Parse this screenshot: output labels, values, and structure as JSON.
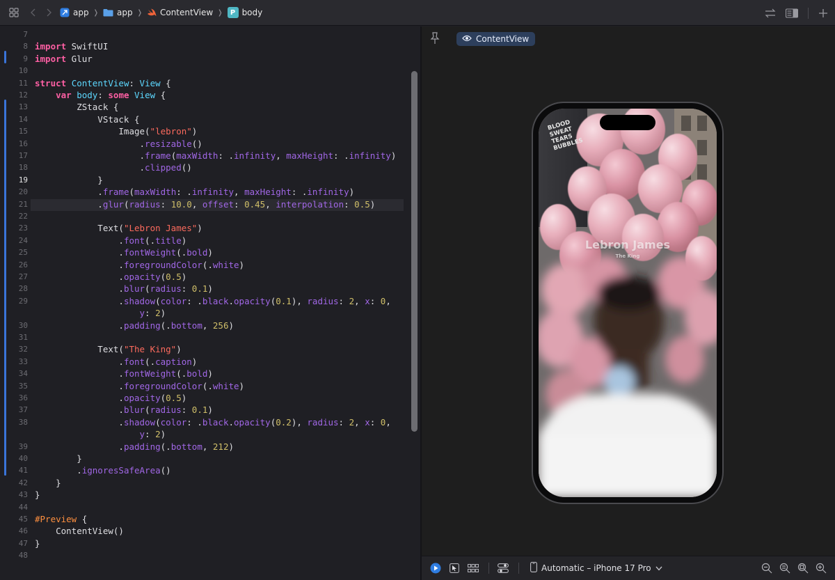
{
  "breadcrumb": [
    {
      "label": "app",
      "icon": "app-project-icon"
    },
    {
      "label": "app",
      "icon": "folder-icon"
    },
    {
      "label": "ContentView",
      "icon": "swift-icon"
    },
    {
      "label": "body",
      "icon": "property-icon",
      "badge": "P"
    }
  ],
  "code_lines": [
    {
      "n": "7",
      "tokens": []
    },
    {
      "n": "8",
      "tokens": [
        [
          "kw",
          "import"
        ],
        [
          "plain",
          " SwiftUI"
        ]
      ]
    },
    {
      "n": "9",
      "tokens": [
        [
          "kw",
          "import"
        ],
        [
          "plain",
          " Glur"
        ]
      ]
    },
    {
      "n": "10",
      "tokens": []
    },
    {
      "n": "11",
      "tokens": [
        [
          "kw",
          "struct"
        ],
        [
          "plain",
          " "
        ],
        [
          "type",
          "ContentView"
        ],
        [
          "plain",
          ": "
        ],
        [
          "type",
          "View"
        ],
        [
          "plain",
          " {"
        ]
      ]
    },
    {
      "n": "12",
      "tokens": [
        [
          "plain",
          "    "
        ],
        [
          "kw",
          "var"
        ],
        [
          "plain",
          " "
        ],
        [
          "type",
          "body"
        ],
        [
          "plain",
          ": "
        ],
        [
          "kw",
          "some"
        ],
        [
          "plain",
          " "
        ],
        [
          "type",
          "View"
        ],
        [
          "plain",
          " {"
        ]
      ]
    },
    {
      "n": "13",
      "tokens": [
        [
          "plain",
          "        ZStack {"
        ]
      ]
    },
    {
      "n": "14",
      "tokens": [
        [
          "plain",
          "            VStack {"
        ]
      ]
    },
    {
      "n": "15",
      "tokens": [
        [
          "plain",
          "                Image("
        ],
        [
          "str",
          "\"lebron\""
        ],
        [
          "plain",
          ")"
        ]
      ]
    },
    {
      "n": "16",
      "tokens": [
        [
          "plain",
          "                    ."
        ],
        [
          "fn",
          "resizable"
        ],
        [
          "plain",
          "()"
        ]
      ]
    },
    {
      "n": "17",
      "tokens": [
        [
          "plain",
          "                    ."
        ],
        [
          "fn",
          "frame"
        ],
        [
          "plain",
          "("
        ],
        [
          "fn",
          "maxWidth"
        ],
        [
          "plain",
          ": ."
        ],
        [
          "fn",
          "infinity"
        ],
        [
          "plain",
          ", "
        ],
        [
          "fn",
          "maxHeight"
        ],
        [
          "plain",
          ": ."
        ],
        [
          "fn",
          "infinity"
        ],
        [
          "plain",
          ")"
        ]
      ]
    },
    {
      "n": "18",
      "tokens": [
        [
          "plain",
          "                    ."
        ],
        [
          "fn",
          "clipped"
        ],
        [
          "plain",
          "()"
        ]
      ]
    },
    {
      "n": "19",
      "tokens": [
        [
          "plain",
          "            }"
        ]
      ]
    },
    {
      "n": "20",
      "tokens": [
        [
          "plain",
          "            ."
        ],
        [
          "fn",
          "frame"
        ],
        [
          "plain",
          "("
        ],
        [
          "fn",
          "maxWidth"
        ],
        [
          "plain",
          ": ."
        ],
        [
          "fn",
          "infinity"
        ],
        [
          "plain",
          ", "
        ],
        [
          "fn",
          "maxHeight"
        ],
        [
          "plain",
          ": ."
        ],
        [
          "fn",
          "infinity"
        ],
        [
          "plain",
          ")"
        ]
      ]
    },
    {
      "n": "21",
      "tokens": [
        [
          "plain",
          "            ."
        ],
        [
          "fn",
          "glur"
        ],
        [
          "plain",
          "("
        ],
        [
          "fn",
          "radius"
        ],
        [
          "plain",
          ": "
        ],
        [
          "num",
          "10.0"
        ],
        [
          "plain",
          ", "
        ],
        [
          "fn",
          "offset"
        ],
        [
          "plain",
          ": "
        ],
        [
          "num",
          "0.45"
        ],
        [
          "plain",
          ", "
        ],
        [
          "fn",
          "interpolation"
        ],
        [
          "plain",
          ": "
        ],
        [
          "num",
          "0.5"
        ],
        [
          "plain",
          ")"
        ]
      ]
    },
    {
      "n": "22",
      "tokens": []
    },
    {
      "n": "23",
      "tokens": [
        [
          "plain",
          "            Text("
        ],
        [
          "str",
          "\"Lebron James\""
        ],
        [
          "plain",
          ")"
        ]
      ]
    },
    {
      "n": "24",
      "tokens": [
        [
          "plain",
          "                ."
        ],
        [
          "fn",
          "font"
        ],
        [
          "plain",
          "(."
        ],
        [
          "fn",
          "title"
        ],
        [
          "plain",
          ")"
        ]
      ]
    },
    {
      "n": "25",
      "tokens": [
        [
          "plain",
          "                ."
        ],
        [
          "fn",
          "fontWeight"
        ],
        [
          "plain",
          "(."
        ],
        [
          "fn",
          "bold"
        ],
        [
          "plain",
          ")"
        ]
      ]
    },
    {
      "n": "26",
      "tokens": [
        [
          "plain",
          "                ."
        ],
        [
          "fn",
          "foregroundColor"
        ],
        [
          "plain",
          "(."
        ],
        [
          "fn",
          "white"
        ],
        [
          "plain",
          ")"
        ]
      ]
    },
    {
      "n": "27",
      "tokens": [
        [
          "plain",
          "                ."
        ],
        [
          "fn",
          "opacity"
        ],
        [
          "plain",
          "("
        ],
        [
          "num",
          "0.5"
        ],
        [
          "plain",
          ")"
        ]
      ]
    },
    {
      "n": "28",
      "tokens": [
        [
          "plain",
          "                ."
        ],
        [
          "fn",
          "blur"
        ],
        [
          "plain",
          "("
        ],
        [
          "fn",
          "radius"
        ],
        [
          "plain",
          ": "
        ],
        [
          "num",
          "0.1"
        ],
        [
          "plain",
          ")"
        ]
      ]
    },
    {
      "n": "29",
      "tokens": [
        [
          "plain",
          "                ."
        ],
        [
          "fn",
          "shadow"
        ],
        [
          "plain",
          "("
        ],
        [
          "fn",
          "color"
        ],
        [
          "plain",
          ": ."
        ],
        [
          "fn",
          "black"
        ],
        [
          "plain",
          "."
        ],
        [
          "fn",
          "opacity"
        ],
        [
          "plain",
          "("
        ],
        [
          "num",
          "0.1"
        ],
        [
          "plain",
          "), "
        ],
        [
          "fn",
          "radius"
        ],
        [
          "plain",
          ": "
        ],
        [
          "num",
          "2"
        ],
        [
          "plain",
          ", "
        ],
        [
          "fn",
          "x"
        ],
        [
          "plain",
          ": "
        ],
        [
          "num",
          "0"
        ],
        [
          "plain",
          ","
        ]
      ]
    },
    {
      "n": "",
      "tokens": [
        [
          "plain",
          "                    "
        ],
        [
          "fn",
          "y"
        ],
        [
          "plain",
          ": "
        ],
        [
          "num",
          "2"
        ],
        [
          "plain",
          ")"
        ]
      ]
    },
    {
      "n": "30",
      "tokens": [
        [
          "plain",
          "                ."
        ],
        [
          "fn",
          "padding"
        ],
        [
          "plain",
          "(."
        ],
        [
          "fn",
          "bottom"
        ],
        [
          "plain",
          ", "
        ],
        [
          "num",
          "256"
        ],
        [
          "plain",
          ")"
        ]
      ]
    },
    {
      "n": "31",
      "tokens": []
    },
    {
      "n": "32",
      "tokens": [
        [
          "plain",
          "            Text("
        ],
        [
          "str",
          "\"The King\""
        ],
        [
          "plain",
          ")"
        ]
      ]
    },
    {
      "n": "33",
      "tokens": [
        [
          "plain",
          "                ."
        ],
        [
          "fn",
          "font"
        ],
        [
          "plain",
          "(."
        ],
        [
          "fn",
          "caption"
        ],
        [
          "plain",
          ")"
        ]
      ]
    },
    {
      "n": "34",
      "tokens": [
        [
          "plain",
          "                ."
        ],
        [
          "fn",
          "fontWeight"
        ],
        [
          "plain",
          "(."
        ],
        [
          "fn",
          "bold"
        ],
        [
          "plain",
          ")"
        ]
      ]
    },
    {
      "n": "35",
      "tokens": [
        [
          "plain",
          "                ."
        ],
        [
          "fn",
          "foregroundColor"
        ],
        [
          "plain",
          "(."
        ],
        [
          "fn",
          "white"
        ],
        [
          "plain",
          ")"
        ]
      ]
    },
    {
      "n": "36",
      "tokens": [
        [
          "plain",
          "                ."
        ],
        [
          "fn",
          "opacity"
        ],
        [
          "plain",
          "("
        ],
        [
          "num",
          "0.5"
        ],
        [
          "plain",
          ")"
        ]
      ]
    },
    {
      "n": "37",
      "tokens": [
        [
          "plain",
          "                ."
        ],
        [
          "fn",
          "blur"
        ],
        [
          "plain",
          "("
        ],
        [
          "fn",
          "radius"
        ],
        [
          "plain",
          ": "
        ],
        [
          "num",
          "0.1"
        ],
        [
          "plain",
          ")"
        ]
      ]
    },
    {
      "n": "38",
      "tokens": [
        [
          "plain",
          "                ."
        ],
        [
          "fn",
          "shadow"
        ],
        [
          "plain",
          "("
        ],
        [
          "fn",
          "color"
        ],
        [
          "plain",
          ": ."
        ],
        [
          "fn",
          "black"
        ],
        [
          "plain",
          "."
        ],
        [
          "fn",
          "opacity"
        ],
        [
          "plain",
          "("
        ],
        [
          "num",
          "0.2"
        ],
        [
          "plain",
          "), "
        ],
        [
          "fn",
          "radius"
        ],
        [
          "plain",
          ": "
        ],
        [
          "num",
          "2"
        ],
        [
          "plain",
          ", "
        ],
        [
          "fn",
          "x"
        ],
        [
          "plain",
          ": "
        ],
        [
          "num",
          "0"
        ],
        [
          "plain",
          ","
        ]
      ]
    },
    {
      "n": "",
      "tokens": [
        [
          "plain",
          "                    "
        ],
        [
          "fn",
          "y"
        ],
        [
          "plain",
          ": "
        ],
        [
          "num",
          "2"
        ],
        [
          "plain",
          ")"
        ]
      ]
    },
    {
      "n": "39",
      "tokens": [
        [
          "plain",
          "                ."
        ],
        [
          "fn",
          "padding"
        ],
        [
          "plain",
          "(."
        ],
        [
          "fn",
          "bottom"
        ],
        [
          "plain",
          ", "
        ],
        [
          "num",
          "212"
        ],
        [
          "plain",
          ")"
        ]
      ]
    },
    {
      "n": "40",
      "tokens": [
        [
          "plain",
          "        }"
        ]
      ]
    },
    {
      "n": "41",
      "tokens": [
        [
          "plain",
          "        ."
        ],
        [
          "fn",
          "ignoresSafeArea"
        ],
        [
          "plain",
          "()"
        ]
      ]
    },
    {
      "n": "42",
      "tokens": [
        [
          "plain",
          "    }"
        ]
      ]
    },
    {
      "n": "43",
      "tokens": [
        [
          "plain",
          "}"
        ]
      ]
    },
    {
      "n": "44",
      "tokens": []
    },
    {
      "n": "45",
      "tokens": [
        [
          "mac",
          "#Preview"
        ],
        [
          "plain",
          " {"
        ]
      ]
    },
    {
      "n": "46",
      "tokens": [
        [
          "plain",
          "    ContentView()"
        ]
      ]
    },
    {
      "n": "47",
      "tokens": [
        [
          "plain",
          "}"
        ]
      ]
    },
    {
      "n": "48",
      "tokens": []
    }
  ],
  "current_line": "19",
  "preview": {
    "tab_label": "ContentView",
    "title_text": "Lebron James",
    "subtitle_text": "The King",
    "sign_lines": [
      "BLOOD",
      "SWEAT",
      "TEARS",
      "BUBBLES"
    ]
  },
  "canvas_bar": {
    "device_label": "Automatic – iPhone 17 Pro"
  },
  "colors": {
    "keyword": "#fc5fa3",
    "string": "#fc6a5d",
    "number": "#d0bf69",
    "method": "#a167e6",
    "type": "#5dd8ff",
    "accent": "#3a74d9"
  }
}
